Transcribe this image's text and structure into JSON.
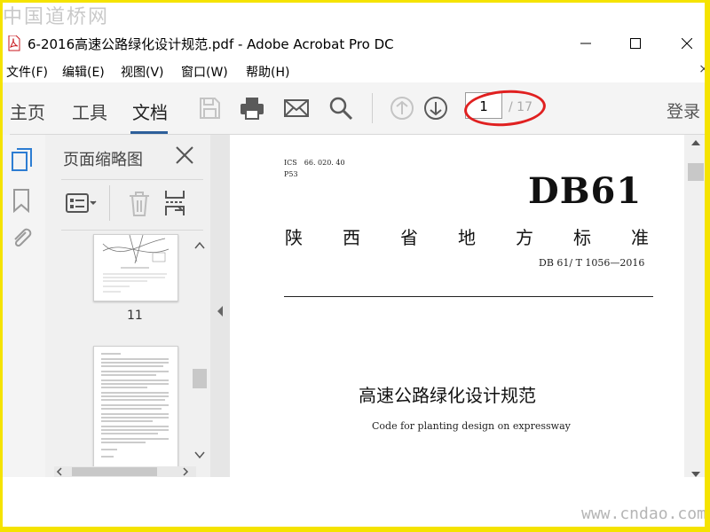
{
  "watermark": {
    "top": "中国道桥网",
    "bottom": "www.cndao.com"
  },
  "window": {
    "title": "6-2016高速公路绿化设计规范.pdf - Adobe Acrobat Pro DC"
  },
  "menu": {
    "items": [
      {
        "label": "文件(F)"
      },
      {
        "label": "编辑(E)"
      },
      {
        "label": "视图(V)"
      },
      {
        "label": "窗口(W)"
      },
      {
        "label": "帮助(H)"
      }
    ],
    "close_glyph": "×"
  },
  "toolbar": {
    "tabs": [
      {
        "label": "主页"
      },
      {
        "label": "工具"
      },
      {
        "label": "文档",
        "active": true
      }
    ],
    "page_current": "1",
    "page_total": "/ 17",
    "login": "登录",
    "accent": "#2d5f9a",
    "highlight": "#e02020"
  },
  "panel": {
    "title": "页面缩略图",
    "thumb_label": "11"
  },
  "document": {
    "ics": "ICS　66. 020. 40",
    "p": "P53",
    "code": "DB61",
    "province_chars": [
      "陕",
      "西",
      "省",
      "地",
      "方",
      "标",
      "准"
    ],
    "std_no": "DB 61/ T 1056—2016",
    "title_cn": "高速公路绿化设计规范",
    "title_en": "Code for planting design on expressway"
  }
}
